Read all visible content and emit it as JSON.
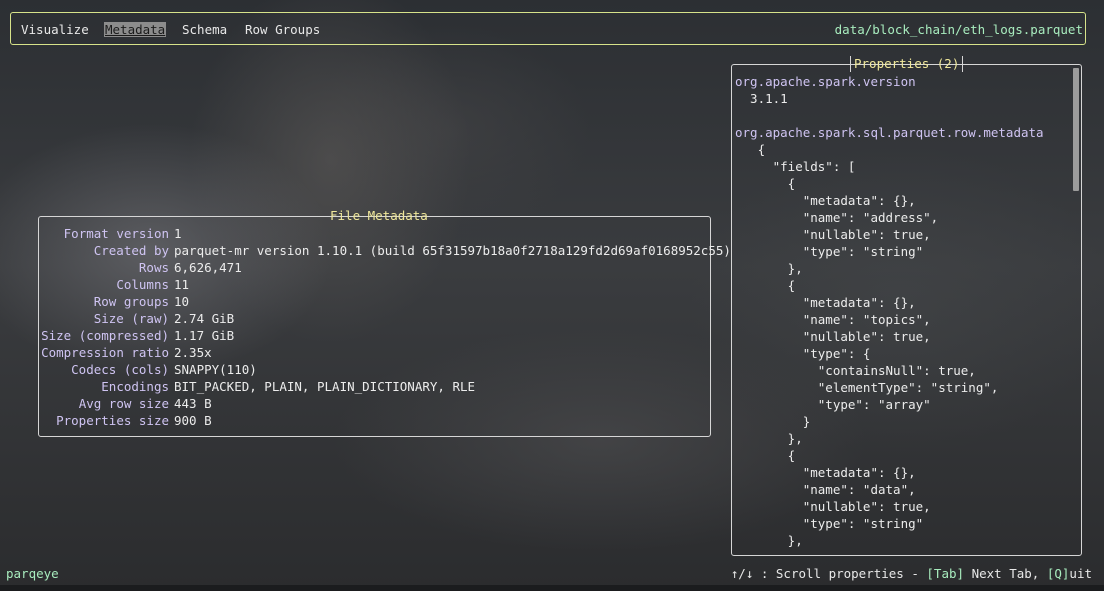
{
  "tabs": [
    {
      "label": "Visualize",
      "active": false
    },
    {
      "label": "Metadata",
      "active": true
    },
    {
      "label": "Schema",
      "active": false
    },
    {
      "label": "Row Groups",
      "active": false
    }
  ],
  "file_path": "data/block_chain/eth_logs.parquet",
  "file_metadata": {
    "title": "File Metadata",
    "rows": [
      {
        "key": "Format version",
        "value": "1"
      },
      {
        "key": "Created by",
        "value": "parquet-mr version 1.10.1 (build 65f31597b18a0f2718a129fd2d69af0168952c55)"
      },
      {
        "key": "Rows",
        "value": "6,626,471"
      },
      {
        "key": "Columns",
        "value": "11"
      },
      {
        "key": "Row groups",
        "value": "10"
      },
      {
        "key": "Size (raw)",
        "value": "2.74 GiB"
      },
      {
        "key": "Size (compressed)",
        "value": "1.17 GiB"
      },
      {
        "key": "Compression ratio",
        "value": "2.35x"
      },
      {
        "key": "Codecs (cols)",
        "value": "SNAPPY(110)"
      },
      {
        "key": "Encodings",
        "value": "BIT_PACKED, PLAIN, PLAIN_DICTIONARY, RLE"
      },
      {
        "key": "Avg row size",
        "value": "443 B"
      },
      {
        "key": "Properties size",
        "value": "900 B"
      }
    ]
  },
  "properties": {
    "title": "Properties (2)",
    "lines": [
      {
        "text": "org.apache.spark.version",
        "kind": "key"
      },
      {
        "text": "  3.1.1",
        "kind": "value"
      },
      {
        "text": "",
        "kind": "value"
      },
      {
        "text": "org.apache.spark.sql.parquet.row.metadata",
        "kind": "key"
      },
      {
        "text": "   {",
        "kind": "value"
      },
      {
        "text": "     \"fields\": [",
        "kind": "value"
      },
      {
        "text": "       {",
        "kind": "value"
      },
      {
        "text": "         \"metadata\": {},",
        "kind": "value"
      },
      {
        "text": "         \"name\": \"address\",",
        "kind": "value"
      },
      {
        "text": "         \"nullable\": true,",
        "kind": "value"
      },
      {
        "text": "         \"type\": \"string\"",
        "kind": "value"
      },
      {
        "text": "       },",
        "kind": "value"
      },
      {
        "text": "       {",
        "kind": "value"
      },
      {
        "text": "         \"metadata\": {},",
        "kind": "value"
      },
      {
        "text": "         \"name\": \"topics\",",
        "kind": "value"
      },
      {
        "text": "         \"nullable\": true,",
        "kind": "value"
      },
      {
        "text": "         \"type\": {",
        "kind": "value"
      },
      {
        "text": "           \"containsNull\": true,",
        "kind": "value"
      },
      {
        "text": "           \"elementType\": \"string\",",
        "kind": "value"
      },
      {
        "text": "           \"type\": \"array\"",
        "kind": "value"
      },
      {
        "text": "         }",
        "kind": "value"
      },
      {
        "text": "       },",
        "kind": "value"
      },
      {
        "text": "       {",
        "kind": "value"
      },
      {
        "text": "         \"metadata\": {},",
        "kind": "value"
      },
      {
        "text": "         \"name\": \"data\",",
        "kind": "value"
      },
      {
        "text": "         \"nullable\": true,",
        "kind": "value"
      },
      {
        "text": "         \"type\": \"string\"",
        "kind": "value"
      },
      {
        "text": "       },",
        "kind": "value"
      }
    ],
    "scroll_fraction_visible": 0.26
  },
  "status": {
    "app_name": "parqeye",
    "help_parts": [
      {
        "text": "↑/↓ : Scroll properties - ",
        "kind": "text"
      },
      {
        "text": "[Tab]",
        "kind": "key"
      },
      {
        "text": " Next Tab, ",
        "kind": "text"
      },
      {
        "text": "[Q]",
        "kind": "key"
      },
      {
        "text": "uit",
        "kind": "text"
      }
    ]
  },
  "colors": {
    "accent_border": "#d7e38a",
    "path_green": "#a8ecbe",
    "panel_title_yellow": "#f0e89a",
    "key_lavender": "#cfc4f2"
  }
}
